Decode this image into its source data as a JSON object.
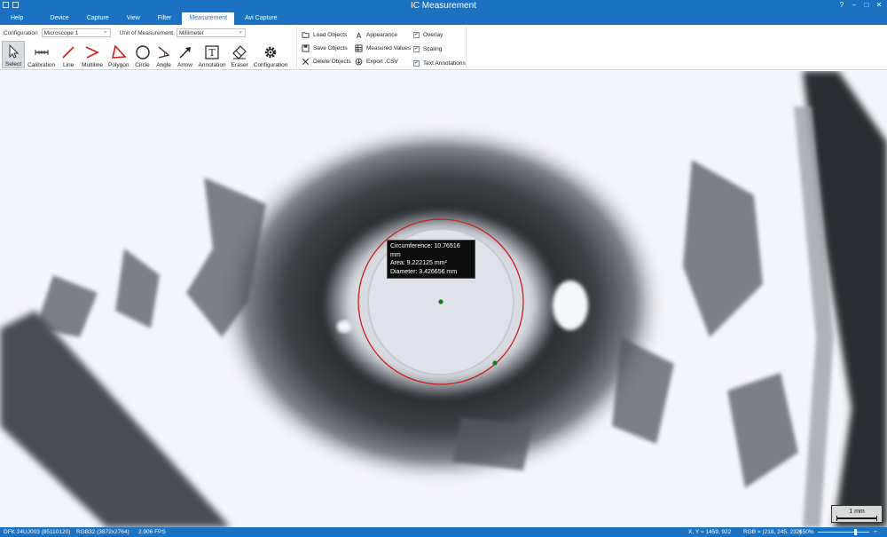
{
  "window": {
    "title": "IC Measurement"
  },
  "tabs": [
    {
      "label": "Help"
    },
    {
      "label": "Device"
    },
    {
      "label": "Capture"
    },
    {
      "label": "View"
    },
    {
      "label": "Filter"
    },
    {
      "label": "Measurement",
      "active": true
    },
    {
      "label": "Avi Capture"
    }
  ],
  "config": {
    "configuration_label": "Configuration",
    "configuration_value": "Microscope 1",
    "unit_label": "Unit of Measurement",
    "unit_value": "Millimeter"
  },
  "tools": [
    {
      "label": "Select",
      "icon": "cursor-icon",
      "selected": true
    },
    {
      "label": "Calibration",
      "icon": "calibration-icon"
    },
    {
      "label": "Line",
      "icon": "line-icon"
    },
    {
      "label": "Multiline",
      "icon": "multiline-icon"
    },
    {
      "label": "Polygon",
      "icon": "polygon-icon"
    },
    {
      "label": "Circle",
      "icon": "circle-icon"
    },
    {
      "label": "Angle",
      "icon": "angle-icon"
    },
    {
      "label": "Arrow",
      "icon": "arrow-icon"
    },
    {
      "label": "Annotation",
      "icon": "text-icon"
    },
    {
      "label": "Eraser",
      "icon": "eraser-icon"
    },
    {
      "label": "Configuration",
      "icon": "gear-icon"
    }
  ],
  "objects": {
    "load": "Load Objects",
    "save": "Save Objects",
    "delete": "Delete Objects",
    "appearance": "Appearance",
    "measured": "Measured Values",
    "export": "Export .CSV"
  },
  "display_options": [
    {
      "label": "Overlay",
      "checked": true
    },
    {
      "label": "Scaling",
      "checked": true
    },
    {
      "label": "Text Annotations",
      "checked": true
    }
  ],
  "measurement": {
    "circumference": "Circumference: 10.76516 mm",
    "area": "Area: 9.222125 mm²",
    "diameter": "Diameter: 3.426656 mm"
  },
  "scale_bar": {
    "label": "1 mm"
  },
  "status": {
    "device": "DFK 24UJ003 (85110120)",
    "format": "RGB32 (3872x2764)",
    "fps": "2.906 FPS",
    "coords": "X, Y = 1459, 922",
    "rgb": "RGB = (218, 245, 232)",
    "zoom": "650%"
  },
  "colors": {
    "accent": "#1b72c2",
    "measure_circle": "#d11a1a",
    "handle": "#0f7a1e"
  }
}
